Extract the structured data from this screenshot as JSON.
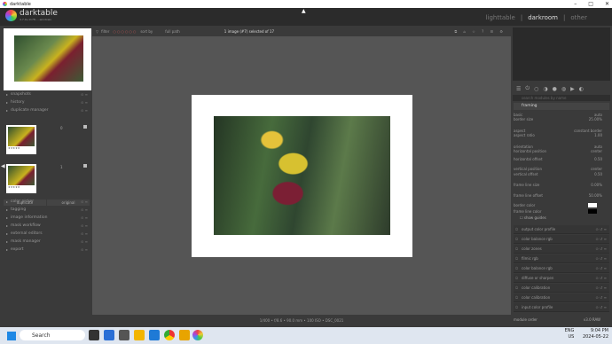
{
  "window": {
    "title": "darktable"
  },
  "brand": {
    "name": "darktable",
    "version": "4.7.0+1178-...-windows"
  },
  "views": [
    "lighttable",
    "darkroom",
    "other"
  ],
  "filterbar": {
    "filter_label": "filter",
    "sort_label": "sort by",
    "sort_value": "full path",
    "count": "1 image (#7) selected of 17"
  },
  "left_modules": {
    "top": [
      "snapshots",
      "history",
      "duplicate manager"
    ],
    "duplicates": [
      {
        "num": "0"
      },
      {
        "num": "1"
      }
    ],
    "dup_buttons": [
      "duplicate",
      "original"
    ],
    "bottom": [
      "color picker",
      "tagging",
      "image information",
      "mask workflow",
      "external editors",
      "mask manager",
      "export"
    ]
  },
  "bottombar": {
    "info": "1/400 • f/8.6 • 90.0 mm • 100 ISO • DSC_0021"
  },
  "right": {
    "search_placeholder": "search modules by name",
    "module_title": "framing",
    "rows": [
      {
        "label": "basic",
        "value": "auto"
      },
      {
        "label": "border size",
        "value": "25.00%"
      },
      {
        "label": "aspect",
        "value": "constant border"
      },
      {
        "label": "aspect ratio",
        "value": "1.00"
      },
      {
        "label": "orientation",
        "value": "auto"
      },
      {
        "label": "horizontal position",
        "value": "center"
      },
      {
        "label": "horizontal offset",
        "value": "0.50"
      },
      {
        "label": "vertical position",
        "value": "center"
      },
      {
        "label": "vertical offset",
        "value": "0.50"
      },
      {
        "label": "frame line size",
        "value": "0.00%"
      },
      {
        "label": "frame line offset",
        "value": "50.00%"
      },
      {
        "label": "border color",
        "value": ""
      },
      {
        "label": "frame line color",
        "value": ""
      }
    ],
    "show_guides": "show guides",
    "modules": [
      "output color profile",
      "color balance rgb",
      "color zones",
      "filmic rgb",
      "color balance rgb",
      "diffuse or sharpen",
      "color calibration",
      "color calibration",
      "input color profile"
    ],
    "module_order_label": "module order",
    "module_order_value": "v3.0 RAW"
  },
  "taskbar": {
    "search": "Search",
    "lang": "ENG\nUS",
    "time": "9:04 PM",
    "date": "2024-05-22"
  }
}
